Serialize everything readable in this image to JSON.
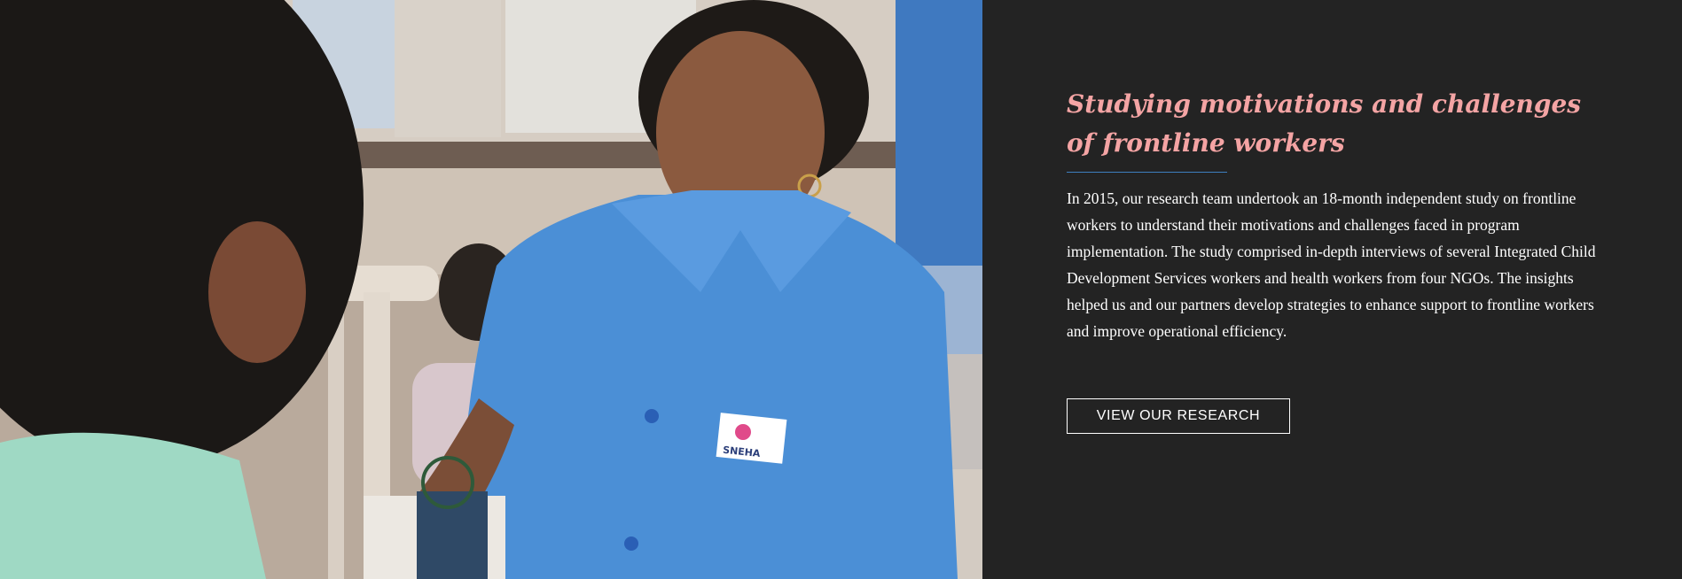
{
  "section": {
    "heading": "Studying motivations and challenges of frontline workers",
    "body": "In 2015, our research team undertook an 18-month independent study on frontline workers to understand their motivations and challenges faced in program implementation. The study comprised in-depth interviews of several Integrated Child Development Services workers and health workers from four NGOs. The insights helped us and our partners develop strategies to enhance support to frontline workers and improve operational efficiency.",
    "button_label": "VIEW OUR RESEARCH"
  },
  "photo": {
    "badge_text": "SNEHA"
  },
  "colors": {
    "panel_background": "#232323",
    "heading": "#f4a4a4",
    "divider": "#3d7fbf",
    "body_text": "#ffffff"
  }
}
